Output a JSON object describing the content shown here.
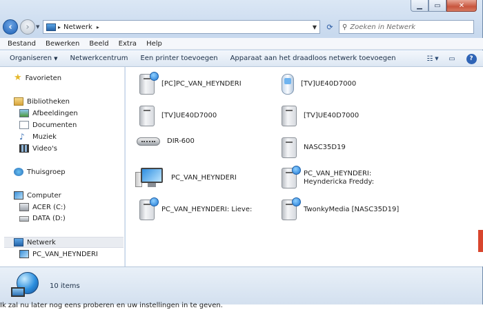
{
  "window": {
    "controls": {
      "minimize": "▁",
      "maximize": "▭",
      "close": "✕"
    }
  },
  "address": {
    "crumb": "Netwerk"
  },
  "search": {
    "placeholder": "Zoeken in Netwerk"
  },
  "menu": [
    "Bestand",
    "Bewerken",
    "Beeld",
    "Extra",
    "Help"
  ],
  "toolbar": {
    "items": [
      "Organiseren",
      "Netwerkcentrum",
      "Een printer toevoegen",
      "Apparaat aan het draadloos netwerk toevoegen"
    ]
  },
  "nav": {
    "favorites": "Favorieten",
    "libraries": "Bibliotheken",
    "lib_items": [
      "Afbeeldingen",
      "Documenten",
      "Muziek",
      "Video's"
    ],
    "homegroup": "Thuisgroep",
    "computer": "Computer",
    "drives": [
      "ACER (C:)",
      "DATA (D:)"
    ],
    "network": "Netwerk",
    "network_child": "PC_VAN_HEYNDERI"
  },
  "devices": [
    {
      "label": "[PC]PC_VAN_HEYNDERI",
      "icon": "media-pc-icon"
    },
    {
      "label": "[TV]UE40D7000",
      "icon": "phone-device-icon"
    },
    {
      "label": "[TV]UE40D7000",
      "icon": "tower-device-icon"
    },
    {
      "label": "[TV]UE40D7000",
      "icon": "tower-device-icon"
    },
    {
      "label": "DIR-600",
      "icon": "router-icon"
    },
    {
      "label": "NASC35D19",
      "icon": "tower-device-icon"
    },
    {
      "label": "PC_VAN_HEYNDERI",
      "icon": "computer-icon"
    },
    {
      "label": "PC_VAN_HEYNDERI: Heyndericka Freddy:",
      "icon": "media-pc-icon"
    },
    {
      "label": "PC_VAN_HEYNDERI: Lieve:",
      "icon": "media-pc-icon"
    },
    {
      "label": "TwonkyMedia [NASC35D19]",
      "icon": "media-pc-icon"
    }
  ],
  "status": {
    "count": "10 items"
  },
  "background": {
    "bottom_text": "Ik zal nu later nog eens proberen en uw instellingen in te geven."
  }
}
